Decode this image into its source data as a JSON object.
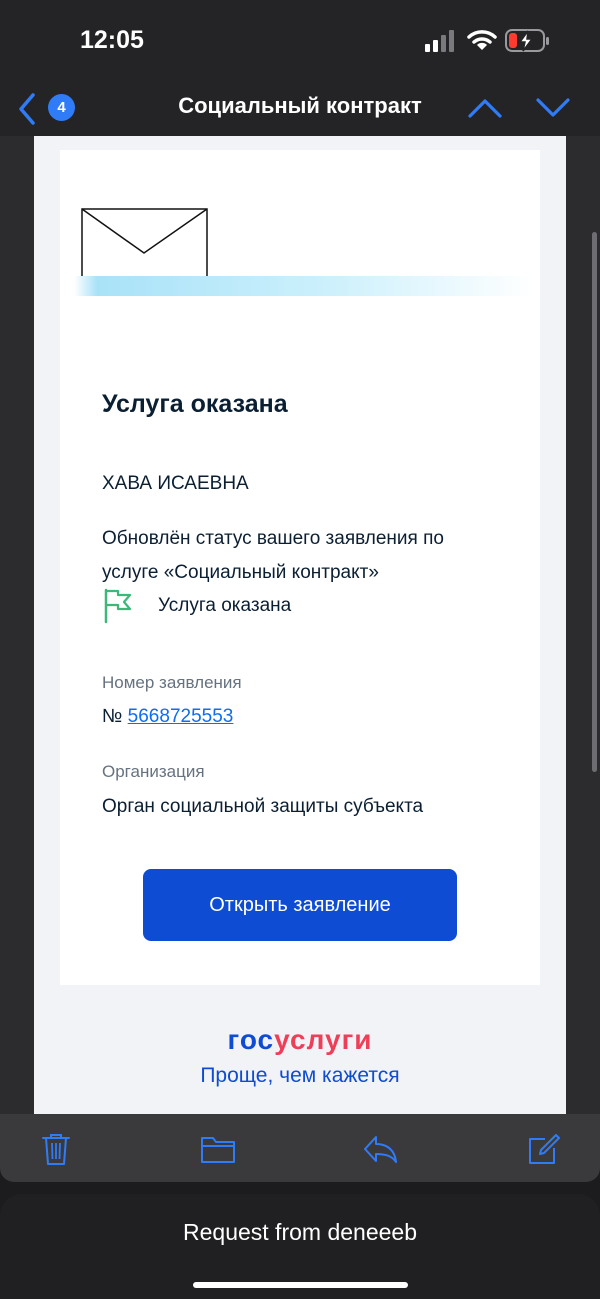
{
  "status_bar": {
    "time": "12:05",
    "battery_color": "#ff3b30"
  },
  "navbar": {
    "unread_count": "4",
    "title": "Социальный контракт",
    "accent": "#2f7cf6"
  },
  "email": {
    "heading": "Услуга оказана",
    "recipient": "ХАВА ИСАЕВНА",
    "message": "Обновлён статус вашего заявления по услуге «Социальный контракт»",
    "status": "Услуга оказана",
    "application_label": "Номер заявления",
    "application_prefix": "№",
    "application_number": "5668725553",
    "organization_label": "Организация",
    "organization": "Орган социальной защиты субъекта",
    "open_button": "Открыть заявление",
    "brand_part1": "гос",
    "brand_part2": "услуги",
    "slogan": "Проще, чем кажется",
    "colors": {
      "brand_blue": "#0d4cd3",
      "brand_red": "#ee3f58",
      "status_green": "#3cb878",
      "link": "#0d6ef0"
    }
  },
  "toolbar": {
    "icons": [
      "trash-icon",
      "folder-icon",
      "reply-icon",
      "compose-icon"
    ]
  },
  "notification": {
    "text": "Request from deneeeb"
  }
}
